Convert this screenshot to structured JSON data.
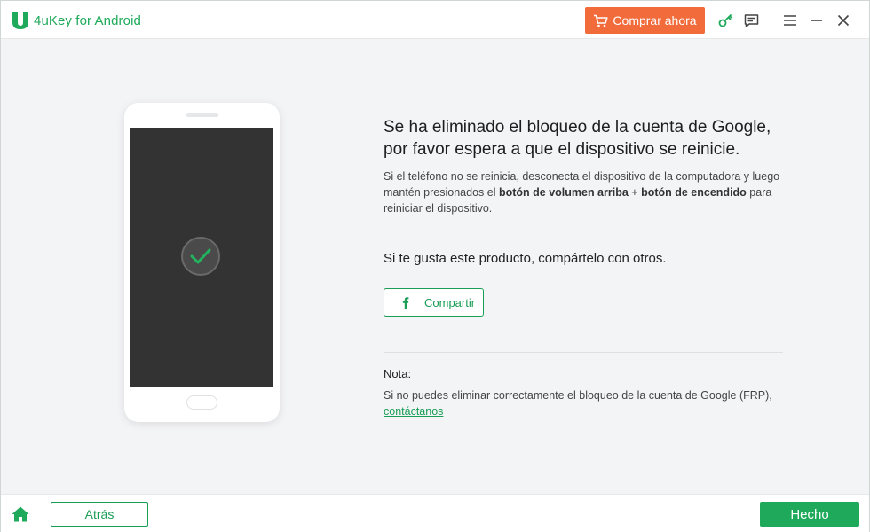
{
  "app": {
    "title": "4uKey for Android",
    "brand_color": "#1faa5b",
    "accent_color": "#f26b3a"
  },
  "header": {
    "buy_label": "Comprar ahora",
    "icons": [
      "cart-icon",
      "key-icon",
      "feedback-icon",
      "menu-icon",
      "minimize-icon",
      "close-icon"
    ]
  },
  "main": {
    "headline_line1": "Se ha eliminado el bloqueo de la cuenta de Google,",
    "headline_line2": "por favor espera a que el dispositivo se reinicie.",
    "desc_part1": "Si el teléfono no se reinicia, desconecta el dispositivo de la computadora y luego mantén presionados el ",
    "desc_bold1": "botón de volumen arriba",
    "desc_part2": " + ",
    "desc_bold2": "botón de encendido",
    "desc_part3": " para reiniciar el dispositivo.",
    "share_prompt": "Si te gusta este producto, compártelo con otros.",
    "share_button": "Compartir",
    "note_label": "Nota:",
    "note_text": "Si no puedes eliminar correctamente el bloqueo de la cuenta de Google (FRP), ",
    "note_link": "contáctanos"
  },
  "footer": {
    "back_label": "Atrás",
    "done_label": "Hecho"
  }
}
